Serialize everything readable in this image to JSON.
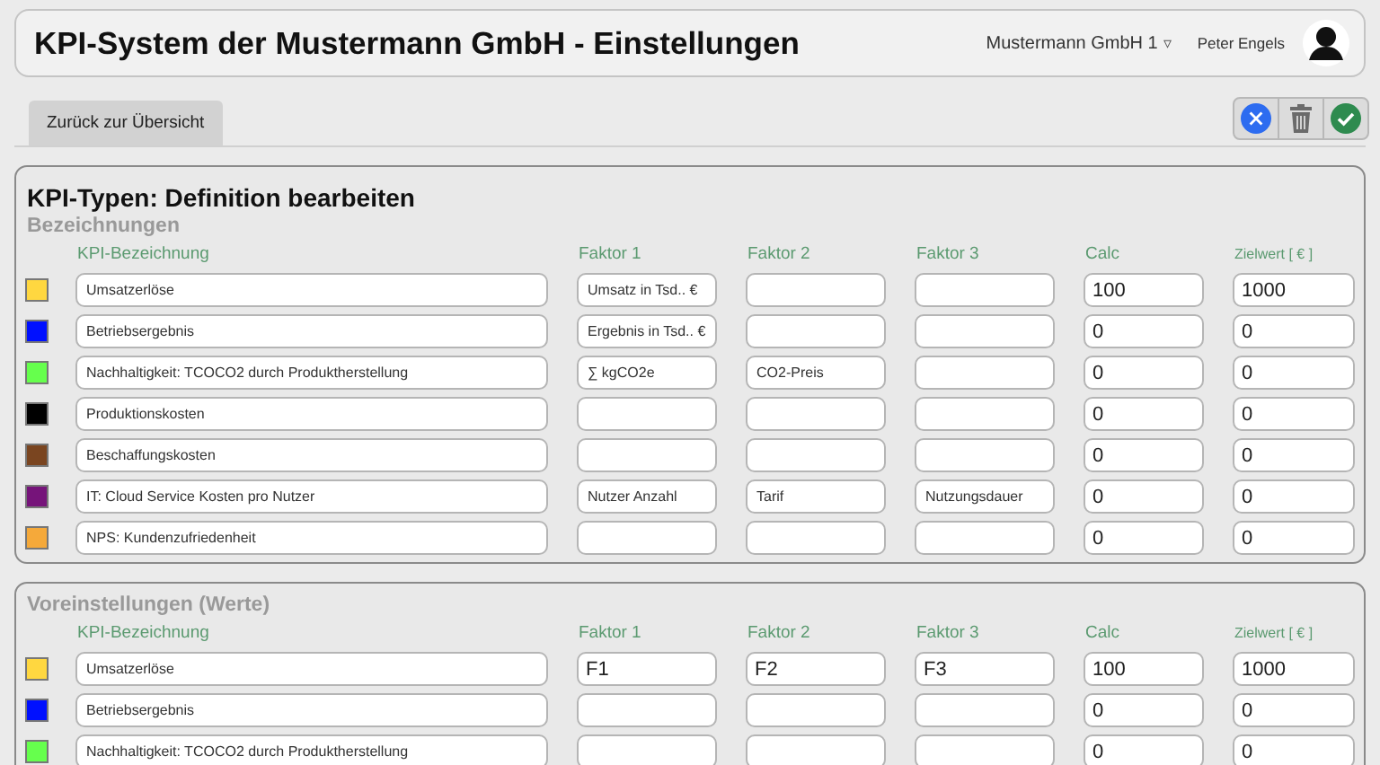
{
  "header": {
    "title": "KPI-System der Mustermann GmbH - Einstellungen",
    "company": "Mustermann GmbH 1",
    "company_caret": "▿",
    "user": "Peter Engels"
  },
  "tabs": [
    {
      "label": "Zurück zur Übersicht",
      "selected": true
    }
  ],
  "toolbar": {
    "buttons": [
      {
        "kind": "cancel"
      },
      {
        "kind": "delete"
      },
      {
        "kind": "confirm"
      }
    ]
  },
  "sections": [
    {
      "title": "KPI-Typen: Definition bearbeiten",
      "subtitle": "Bezeichnungen",
      "columns": [
        "KPI-Bezeichnung",
        "Faktor 1",
        "Faktor 2",
        "Faktor 3",
        "Calc",
        "Zielwert [ € ]"
      ],
      "rows": [
        {
          "color": "#ffd740",
          "name": "Umsatzerlöse",
          "factor_1": "Umsatz in Tsd.. €",
          "calc": "100",
          "target": "1000"
        },
        {
          "color": "#0010ff",
          "name": "Betriebsergebnis",
          "factor_1": "Ergebnis in Tsd.. €",
          "calc": "0",
          "target": "0"
        },
        {
          "color": "#66ff4d",
          "name": "Nachhaltigkeit: TCOCO2 durch Produktherstellung",
          "factor_1": "∑ kgCO2e",
          "factor_2": "CO2-Preis",
          "calc": "0",
          "target": "0"
        },
        {
          "color": "#000000",
          "name": "Produktionskosten",
          "calc": "0",
          "target": "0"
        },
        {
          "color": "#7a4520",
          "name": "Beschaffungskosten",
          "calc": "0",
          "target": "0"
        },
        {
          "color": "#76147a",
          "name": "IT: Cloud Service Kosten pro Nutzer",
          "factor_1": "Nutzer Anzahl",
          "factor_2": "Tarif",
          "factor_3": "Nutzungsdauer",
          "calc": "0",
          "target": "0"
        },
        {
          "color": "#f5a93a",
          "name": "NPS: Kundenzufriedenheit",
          "calc": "0",
          "target": "0"
        }
      ]
    },
    {
      "subtitle": "Voreinstellungen (Werte)",
      "columns": [
        "KPI-Bezeichnung",
        "Faktor 1",
        "Faktor 2",
        "Faktor 3",
        "Calc",
        "Zielwert [ € ]"
      ],
      "rows": [
        {
          "color": "#ffd740",
          "name": "Umsatzerlöse",
          "factor_1": "F1",
          "factor_2": "F2",
          "factor_3": "F3",
          "calc": "100",
          "target": "1000"
        },
        {
          "color": "#0010ff",
          "name": "Betriebsergebnis",
          "calc": "0",
          "target": "0"
        },
        {
          "color": "#66ff4d",
          "name": "Nachhaltigkeit: TCOCO2 durch Produktherstellung",
          "calc": "0",
          "target": "0"
        }
      ]
    }
  ]
}
